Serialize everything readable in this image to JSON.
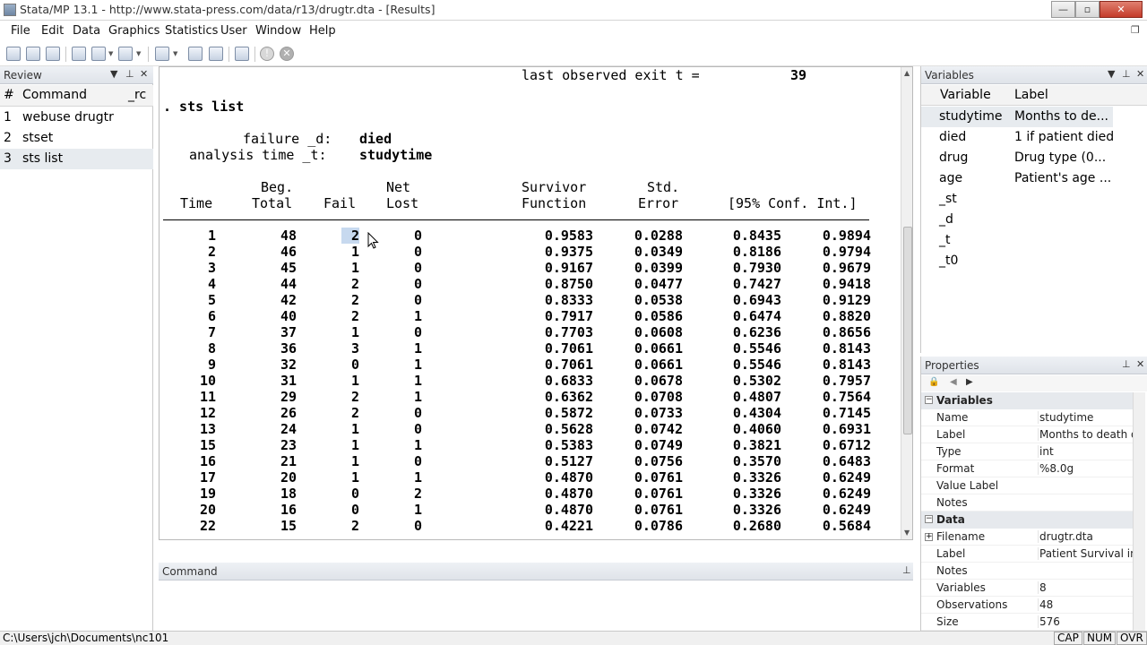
{
  "window": {
    "title": "Stata/MP 13.1 - http://www.stata-press.com/data/r13/drugtr.dta - [Results]",
    "min_glyph": "—",
    "max_glyph": "▫",
    "close_glyph": "✕"
  },
  "menu": [
    "File",
    "Edit",
    "Data",
    "Graphics",
    "Statistics",
    "User",
    "Window",
    "Help"
  ],
  "review": {
    "title": "Review",
    "col_num": "#",
    "col_command": "Command",
    "col_rc": "_rc",
    "items": [
      {
        "num": "1",
        "command": "webuse drugtr"
      },
      {
        "num": "2",
        "command": "stset"
      },
      {
        "num": "3",
        "command": "sts list"
      }
    ]
  },
  "results": {
    "line_exit": "last observed exit t =",
    "exit_value": "39",
    "command_line": ". sts list",
    "failure_label": "failure _d:",
    "failure_value": "died",
    "analysis_label": "analysis time _t:",
    "analysis_value": "studytime",
    "header1": [
      "Beg.",
      "Net",
      "Survivor",
      "Std."
    ],
    "header2": [
      "Time",
      "Total",
      "Fail",
      "Lost",
      "Function",
      "Error",
      "[95% Conf. Int.]"
    ],
    "rows": [
      [
        "1",
        "48",
        "2",
        "0",
        "0.9583",
        "0.0288",
        "0.8435",
        "0.9894"
      ],
      [
        "2",
        "46",
        "1",
        "0",
        "0.9375",
        "0.0349",
        "0.8186",
        "0.9794"
      ],
      [
        "3",
        "45",
        "1",
        "0",
        "0.9167",
        "0.0399",
        "0.7930",
        "0.9679"
      ],
      [
        "4",
        "44",
        "2",
        "0",
        "0.8750",
        "0.0477",
        "0.7427",
        "0.9418"
      ],
      [
        "5",
        "42",
        "2",
        "0",
        "0.8333",
        "0.0538",
        "0.6943",
        "0.9129"
      ],
      [
        "6",
        "40",
        "2",
        "1",
        "0.7917",
        "0.0586",
        "0.6474",
        "0.8820"
      ],
      [
        "7",
        "37",
        "1",
        "0",
        "0.7703",
        "0.0608",
        "0.6236",
        "0.8656"
      ],
      [
        "8",
        "36",
        "3",
        "1",
        "0.7061",
        "0.0661",
        "0.5546",
        "0.8143"
      ],
      [
        "9",
        "32",
        "0",
        "1",
        "0.7061",
        "0.0661",
        "0.5546",
        "0.8143"
      ],
      [
        "10",
        "31",
        "1",
        "1",
        "0.6833",
        "0.0678",
        "0.5302",
        "0.7957"
      ],
      [
        "11",
        "29",
        "2",
        "1",
        "0.6362",
        "0.0708",
        "0.4807",
        "0.7564"
      ],
      [
        "12",
        "26",
        "2",
        "0",
        "0.5872",
        "0.0733",
        "0.4304",
        "0.7145"
      ],
      [
        "13",
        "24",
        "1",
        "0",
        "0.5628",
        "0.0742",
        "0.4060",
        "0.6931"
      ],
      [
        "15",
        "23",
        "1",
        "1",
        "0.5383",
        "0.0749",
        "0.3821",
        "0.6712"
      ],
      [
        "16",
        "21",
        "1",
        "0",
        "0.5127",
        "0.0756",
        "0.3570",
        "0.6483"
      ],
      [
        "17",
        "20",
        "1",
        "1",
        "0.4870",
        "0.0761",
        "0.3326",
        "0.6249"
      ],
      [
        "19",
        "18",
        "0",
        "2",
        "0.4870",
        "0.0761",
        "0.3326",
        "0.6249"
      ],
      [
        "20",
        "16",
        "0",
        "1",
        "0.4870",
        "0.0761",
        "0.3326",
        "0.6249"
      ],
      [
        "22",
        "15",
        "2",
        "0",
        "0.4221",
        "0.0786",
        "0.2680",
        "0.5684"
      ]
    ]
  },
  "command": {
    "title": "Command",
    "value": ""
  },
  "variables": {
    "title": "Variables",
    "col_variable": "Variable",
    "col_label": "Label",
    "items": [
      {
        "name": "studytime",
        "label": "Months to de..."
      },
      {
        "name": "died",
        "label": "1 if patient died"
      },
      {
        "name": "drug",
        "label": "Drug type (0..."
      },
      {
        "name": "age",
        "label": "Patient's age ..."
      },
      {
        "name": "_st",
        "label": ""
      },
      {
        "name": "_d",
        "label": ""
      },
      {
        "name": "_t",
        "label": ""
      },
      {
        "name": "_t0",
        "label": ""
      }
    ]
  },
  "properties": {
    "title": "Properties",
    "section_variables": "Variables",
    "variables_rows": [
      {
        "key": "Name",
        "value": "studytime"
      },
      {
        "key": "Label",
        "value": "Months to death or"
      },
      {
        "key": "Type",
        "value": "int"
      },
      {
        "key": "Format",
        "value": "%8.0g"
      },
      {
        "key": "Value Label",
        "value": ""
      },
      {
        "key": "Notes",
        "value": ""
      }
    ],
    "section_data": "Data",
    "data_rows": [
      {
        "key": "Filename",
        "value": "drugtr.dta"
      },
      {
        "key": "Label",
        "value": "Patient Survival in D"
      },
      {
        "key": "Notes",
        "value": ""
      },
      {
        "key": "Variables",
        "value": "8"
      },
      {
        "key": "Observations",
        "value": "48"
      },
      {
        "key": "Size",
        "value": "576"
      }
    ]
  },
  "status": {
    "path": "C:\\Users\\jch\\Documents\\nc101",
    "indicators": [
      "CAP",
      "NUM",
      "OVR"
    ]
  },
  "colors": {
    "selection": "#c7d9ef",
    "panel_header": "#dfe3e9"
  }
}
